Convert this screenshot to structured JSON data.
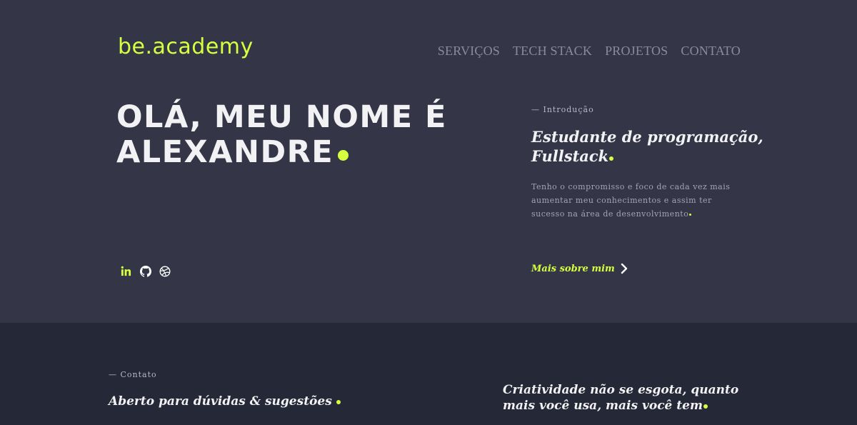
{
  "header": {
    "logo": "be.academy",
    "nav": [
      "SERVIÇOS",
      "TECH STACK",
      "PROJETOS",
      "CONTATO"
    ]
  },
  "hero": {
    "headline_line1": "OLÁ, MEU NOME É",
    "headline_line2": "ALEXANDRE",
    "social_icons": [
      "linkedin-icon",
      "github-icon",
      "dribbble-icon"
    ]
  },
  "intro": {
    "label": "— Introdução",
    "title_line1": "Estudante de programação,",
    "title_line2": "Fullstack",
    "text": "Tenho o compromisso e foco de cada vez mais aumentar meu conhecimentos e assim ter sucesso na área de desenvolvimento",
    "more_label": "Mais sobre mim"
  },
  "contact": {
    "label": "— Contato",
    "title": "Aberto para dúvidas & sugestões",
    "quote": "Criatividade não se esgota, quanto mais você usa, mais você tem"
  },
  "colors": {
    "accent": "#d5ff3f",
    "hero_bg": "#343647",
    "footer_bg": "#252836"
  }
}
